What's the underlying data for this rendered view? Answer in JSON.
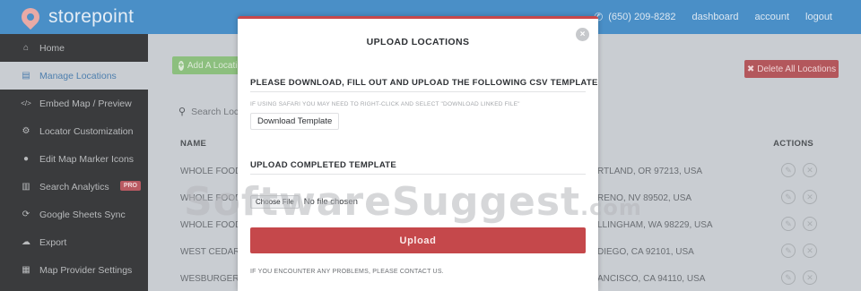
{
  "header": {
    "brand": "storepoint",
    "phone": "(650) 209-8282",
    "nav": [
      "dashboard",
      "account",
      "logout"
    ]
  },
  "sidebar": {
    "items": [
      {
        "label": "Home",
        "icon": "home-icon",
        "glyph": "⌂"
      },
      {
        "label": "Manage Locations",
        "icon": "list-icon",
        "glyph": "▤"
      },
      {
        "label": "Embed Map / Preview",
        "icon": "code-icon",
        "glyph": "</>"
      },
      {
        "label": "Locator Customization",
        "icon": "cogs-icon",
        "glyph": "⚙"
      },
      {
        "label": "Edit Map Marker Icons",
        "icon": "map-marker-icon",
        "glyph": "●"
      },
      {
        "label": "Search Analytics",
        "icon": "chart-icon",
        "glyph": "▥",
        "badge": "PRO"
      },
      {
        "label": "Google Sheets Sync",
        "icon": "sync-icon",
        "glyph": "⟳"
      },
      {
        "label": "Export",
        "icon": "cloud-download-icon",
        "glyph": "☁"
      },
      {
        "label": "Map Provider Settings",
        "icon": "map-icon",
        "glyph": "▦"
      }
    ]
  },
  "main": {
    "add_label": "Add A Location",
    "delete_label": "Delete All Locations",
    "search_placeholder": "Search Locations",
    "col_name": "NAME",
    "col_actions": "ACTIONS",
    "rows": [
      {
        "name": "WHOLE FOODS",
        "address": "RTLAND, OR 97213, USA"
      },
      {
        "name": "WHOLE FOODS",
        "address": "RENO, NV 89502, USA"
      },
      {
        "name": "WHOLE FOODS",
        "address": "LLINGHAM, WA 98229, USA"
      },
      {
        "name": "WEST CEDAR M",
        "address": "DIEGO, CA 92101, USA"
      },
      {
        "name": "WESBURGER",
        "address": "ANCISCO, CA 94110, USA"
      }
    ]
  },
  "modal": {
    "title": "UPLOAD LOCATIONS",
    "section1_title": "PLEASE DOWNLOAD, FILL OUT AND UPLOAD THE FOLLOWING CSV TEMPLATE",
    "safari_hint": "IF USING SAFARI YOU MAY NEED TO RIGHT-CLICK AND SELECT \"DOWNLOAD LINKED FILE\"",
    "download_template": "Download Template",
    "section2_title": "UPLOAD COMPLETED TEMPLATE",
    "choose_file": "Choose File",
    "no_file": "No file chosen",
    "upload": "Upload",
    "contact": "IF YOU ENCOUNTER ANY PROBLEMS, PLEASE CONTACT US.",
    "close_glyph": "×"
  },
  "watermark": {
    "main": "SoftwareSuggest",
    "suffix": ".com"
  },
  "colors": {
    "header": "#4a8fc7",
    "accent_red": "#c5484b",
    "sidebar": "#3a3b3d"
  }
}
